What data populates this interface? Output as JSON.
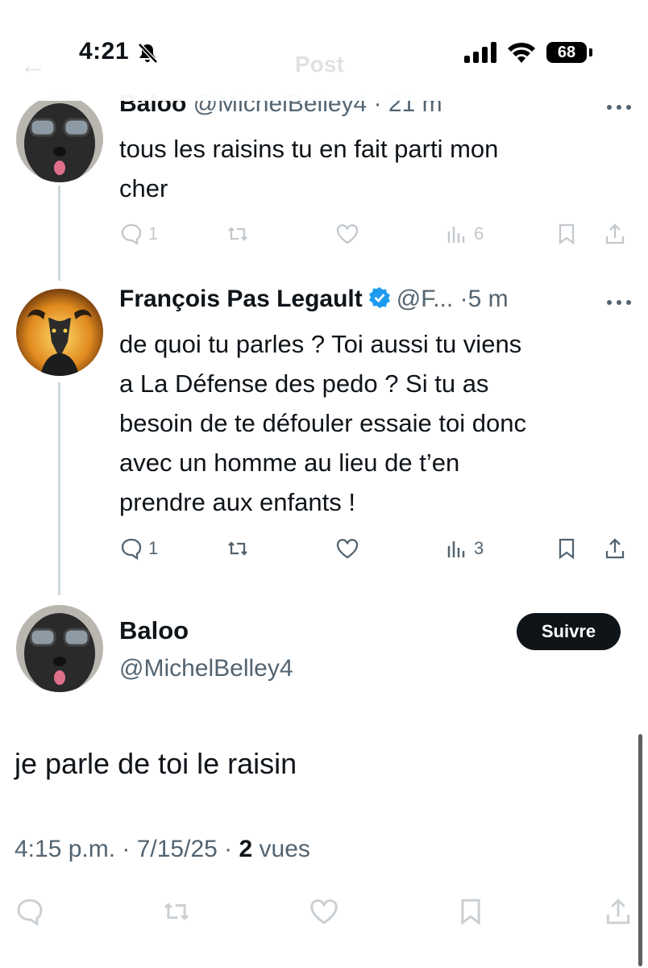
{
  "status_bar": {
    "time": "4:21",
    "battery": "68"
  },
  "header": {
    "back": "←",
    "title": "Post"
  },
  "replies": [
    {
      "name": "Baloo",
      "handle": "@MichelBelley4",
      "time": "· 21 m",
      "text_lines": [
        "tous les raisins tu en fait parti mon",
        "cher"
      ],
      "reply_count": "1",
      "views": "6"
    },
    {
      "name": "François Pas Legault",
      "handle": "@F...",
      "time": "·5 m",
      "text_lines": [
        "de quoi tu parles ? Toi aussi tu viens",
        "a La Défense des pedo ? Si tu as",
        "besoin de te défouler essaie toi donc",
        "avec un homme au lieu de t’en",
        "prendre aux enfants !"
      ],
      "reply_count": "1",
      "views": "3"
    }
  ],
  "main_post": {
    "name": "Baloo",
    "handle": "@MichelBelley4",
    "follow_label": "Suivre",
    "text": "je parle de toi le raisin",
    "timestamp": "4:15 p.m. · 7/15/25 ·",
    "views_count": "2",
    "views_label": "vues"
  },
  "colors": {
    "text": "#0f1419",
    "muted": "#536471",
    "verified": "#1d9bf0",
    "thread_line": "#cfd9de"
  }
}
